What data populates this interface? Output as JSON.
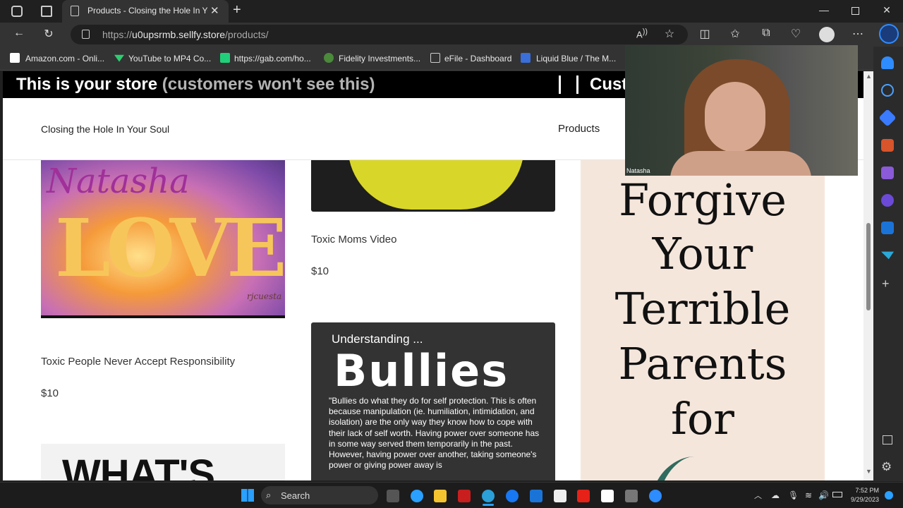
{
  "browser": {
    "tab_title": "Products - Closing the Hole In Yo",
    "url_prefix": "https://",
    "url_host": "u0upsrmb.sellfy.store",
    "url_path": "/products/"
  },
  "bookmarks": [
    {
      "label": "Amazon.com - Onli...",
      "color": "#ffffff"
    },
    {
      "label": "YouTube to MP4 Co...",
      "color": "#2ecc71"
    },
    {
      "label": "https://gab.com/ho...",
      "color": "#21cf7a"
    },
    {
      "label": "Fidelity Investments...",
      "color": "#4a8a3a"
    },
    {
      "label": "eFile - Dashboard",
      "color": "#cccccc"
    },
    {
      "label": "Liquid Blue / The M...",
      "color": "#3a6ed8"
    }
  ],
  "store": {
    "banner_main": "This is your store",
    "banner_note": "(customers won't see this)",
    "customize": "Cust",
    "site_name": "Closing the Hole In Your Soul",
    "nav_products": "Products"
  },
  "products": [
    {
      "title": "Toxic People Never Accept Responsibility",
      "price": "$10"
    },
    {
      "title": "Toxic Moms Video",
      "price": "$10"
    }
  ],
  "images": {
    "love_script": "Natasha",
    "love_big": "LOVE",
    "love_sig": "rjcuesta",
    "bullies_heading": "Understanding ...",
    "bullies_title": "Bullies",
    "bullies_quote": "\"Bullies do what they do for self protection. This is often because manipulation (ie. humiliation, intimidation, and isolation) are the only way they know how to cope with their lack of self worth. Having power over someone has in some way served them temporarily in the past. However, having power over another, taking someone's power or giving power away is",
    "whatis": "WHAT'S",
    "forgive_lines": [
      "Forgive",
      "Your",
      "Terrible",
      "Parents",
      "for"
    ]
  },
  "webcam": {
    "name": "Natasha"
  },
  "taskbar": {
    "search_label": "Search",
    "time": "7:52 PM",
    "date": "9/29/2023"
  },
  "colors": {
    "store_banner": "#000000",
    "accent": "#0078d4"
  }
}
